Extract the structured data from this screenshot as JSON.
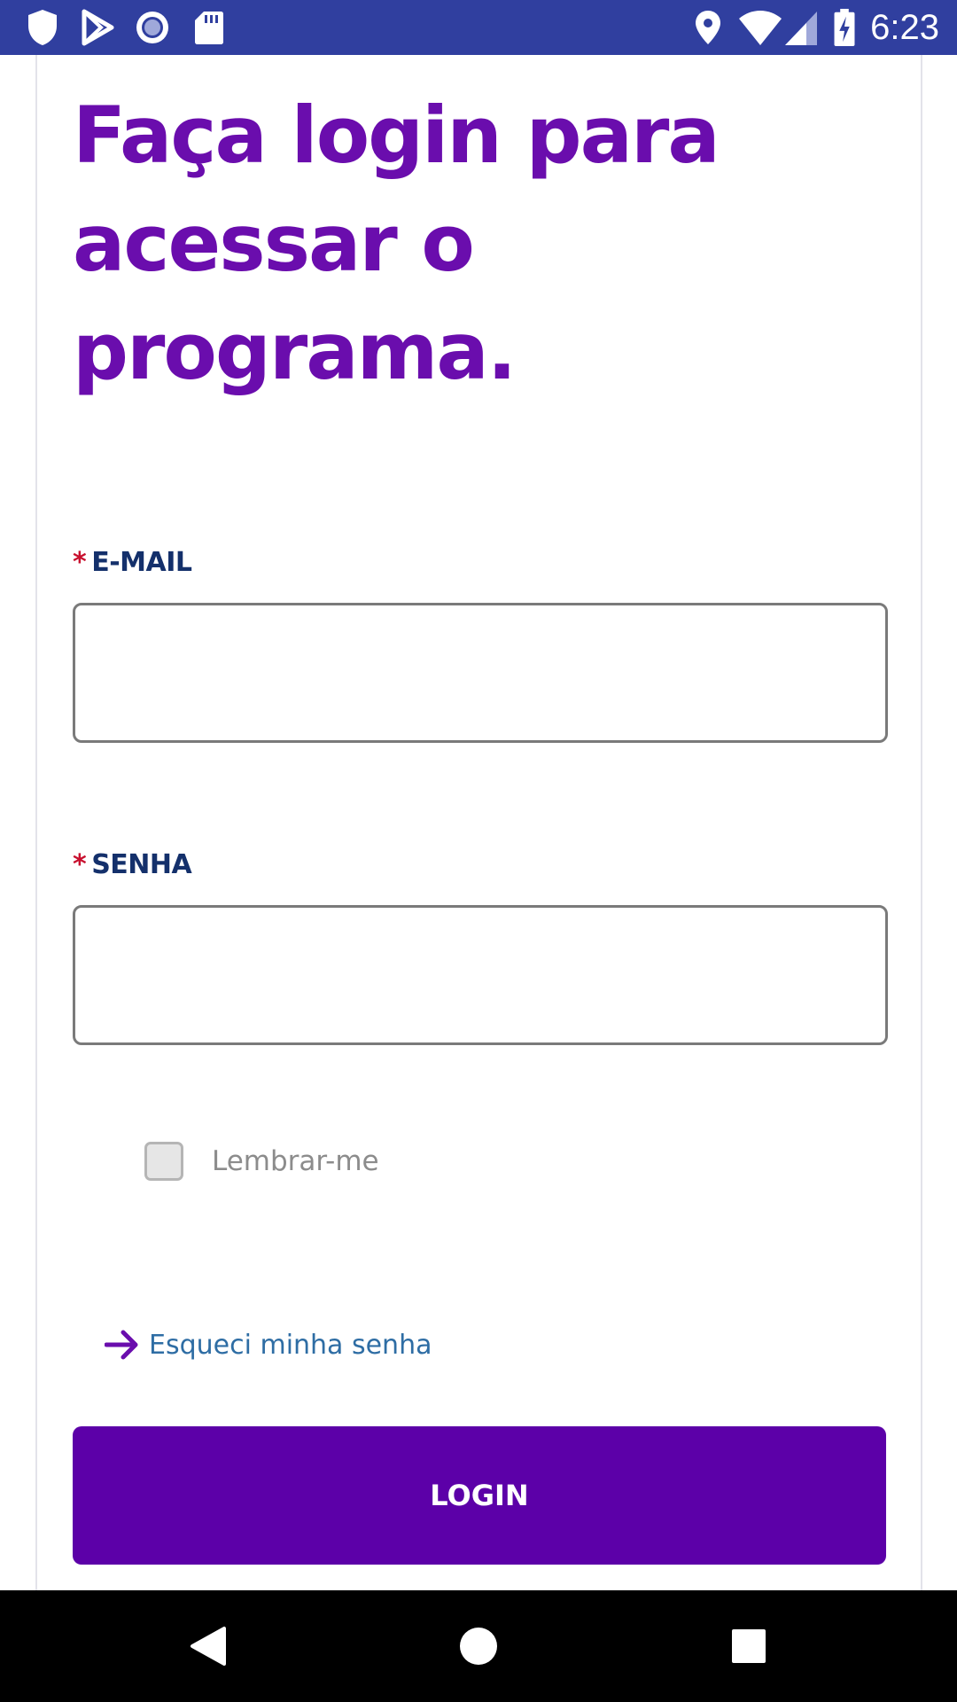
{
  "status_bar": {
    "time": "6:23",
    "background": "#303F9F",
    "left_icons": [
      "shield-icon",
      "play-store-icon",
      "record-icon",
      "sd-card-icon"
    ],
    "right_icons": [
      "location-icon",
      "wifi-icon",
      "cellular-signal-icon",
      "battery-charging-icon"
    ]
  },
  "page": {
    "title": "Faça login para acessar o programa.",
    "title_color": "#6a0dad"
  },
  "form": {
    "required_mark": "*",
    "email_label": "E-MAIL",
    "email_value": "",
    "password_label": "SENHA",
    "password_value": "",
    "remember_label": "Lembrar-me",
    "remember_checked": false,
    "forgot_label": "Esqueci minha senha",
    "forgot_icon": "arrow-right-icon",
    "login_label": "LOGIN",
    "login_color": "#5c00a8"
  },
  "nav_bar": {
    "buttons": [
      "back-icon",
      "home-icon",
      "recents-icon"
    ]
  }
}
